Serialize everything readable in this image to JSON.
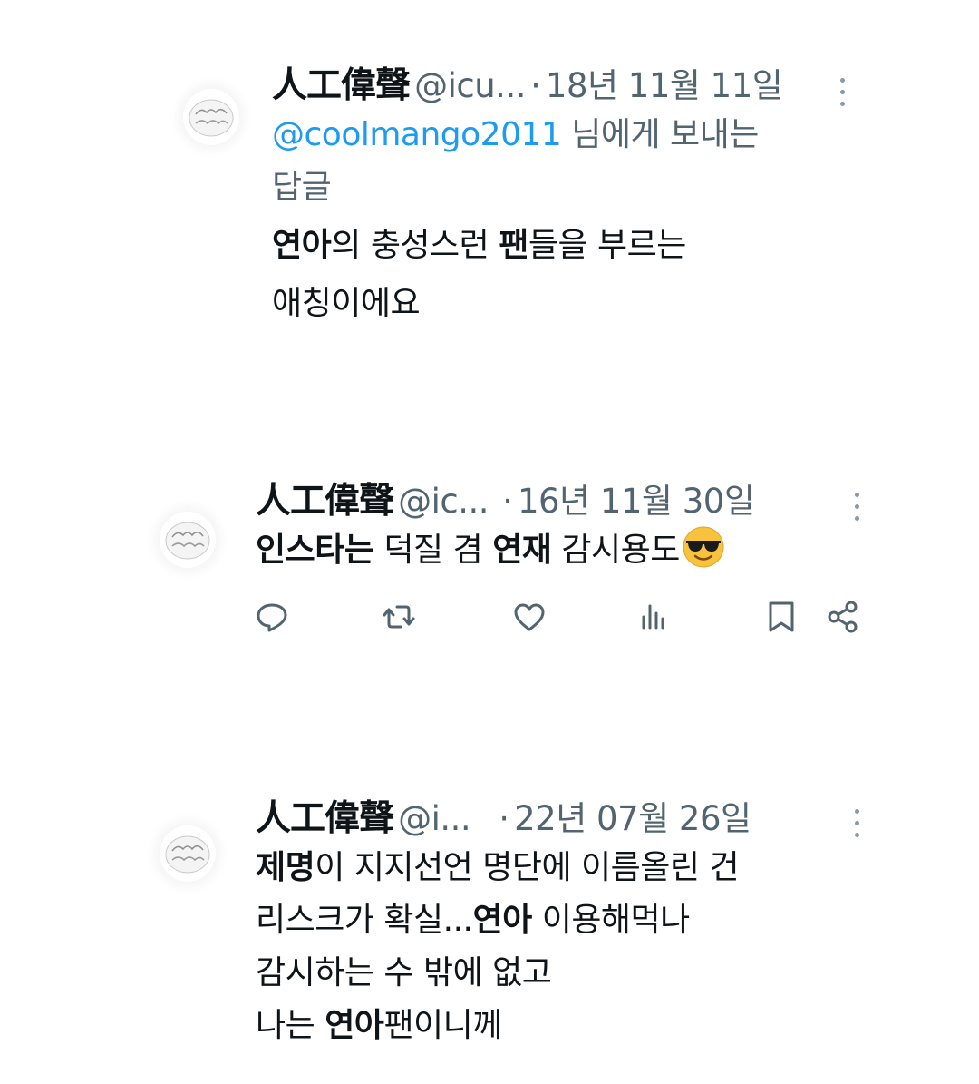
{
  "tweets": [
    {
      "display_name": "人工偉聲",
      "handle": "@icu...",
      "separator": "·",
      "date": "18년 11월 11일",
      "reply_to": {
        "mention": "@coolmango2011",
        "suffix": " 님에게 보내는",
        "line2": "답글"
      },
      "body": {
        "l1_b1": "연아",
        "l1_t1": "의 충성스런 ",
        "l1_b2": "팬",
        "l1_t2": "들을 부르는",
        "l2": "애칭이에요"
      }
    },
    {
      "display_name": "人工偉聲",
      "handle": "@ic...",
      "separator": "·",
      "date": "16년 11월 30일",
      "body": {
        "b1": "인스타는",
        "t1": " 덕질 겸 ",
        "b2": "연재",
        "t2": " 감시용도",
        "emoji": "smiling-face-with-sunglasses"
      }
    },
    {
      "display_name": "人工偉聲",
      "handle": "@i...",
      "separator": "·",
      "date": "22년 07월 26일",
      "body": {
        "l1_b1": "제명",
        "l1_t1": "이 지지선언 명단에 이름올린 건",
        "l2_t1": "리스크가 확실...",
        "l2_b1": "연아",
        "l2_t2": " 이용해먹나",
        "l3": "감시하는 수 밖에 없고",
        "l4_t1": "나는 ",
        "l4_b1": "연아",
        "l4_t2": "팬이니께"
      }
    }
  ],
  "actions": [
    "reply-icon",
    "retweet-icon",
    "like-icon",
    "views-icon",
    "bookmark-icon",
    "share-icon"
  ],
  "colors": {
    "text": "#0f1419",
    "secondary": "#536471",
    "link": "#1d9bf0",
    "background": "#ffffff"
  }
}
